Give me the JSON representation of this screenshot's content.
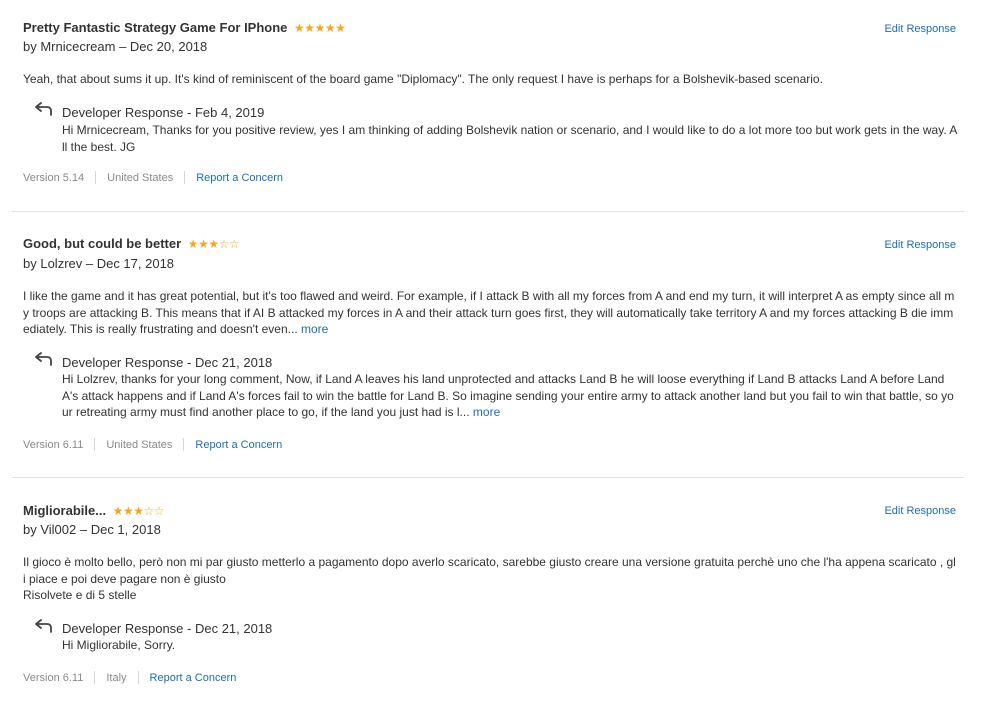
{
  "reviews": [
    {
      "title": "Pretty Fantastic Strategy Game For IPhone",
      "rating": 5,
      "author_line": "by Mrnicecream – Dec 20, 2018",
      "edit_label": "Edit Response",
      "body": "Yeah, that about sums it up. It's kind of reminiscent of the board game \"Diplomacy\". The only request I have is perhaps for a Bolshevik-based scenario.",
      "response_header": "Developer Response - Feb 4, 2019",
      "response_text": "Hi Mrnicecream, Thanks for you positive review, yes I am thinking of adding Bolshevik nation or scenario, and I would like to do a lot more too but work gets in the way. All the best. JG",
      "version": "Version 5.14",
      "country": "United States",
      "concern_label": "Report a Concern"
    },
    {
      "title": "Good, but could be better",
      "rating": 3,
      "author_line": "by Lolzrev – Dec 17, 2018",
      "edit_label": "Edit Response",
      "body": "I like the game and it has great potential, but it's too flawed and weird. For example, if I attack B with all my forces from A and end my turn, it will interpret A as empty since all my troops are attacking B. This means that if AI B attacked my forces in A and their attack turn goes first, they will automatically take territory A and my forces attacking B die immediately. This is really frustrating and doesn't even...",
      "body_more": "more",
      "response_header": "Developer Response - Dec 21, 2018",
      "response_text": "Hi Lolzrev, thanks for your long comment, Now, if Land A leaves his land unprotected and attacks Land B he will loose everything if Land B attacks Land A before Land A's attack happens and if Land A's forces fail to win the battle for Land B. So imagine sending your entire army to attack another land but you fail to win that battle, so your retreating army must find another place to go, if the land you just had is l...",
      "response_more": "more",
      "version": "Version 6.11",
      "country": "United States",
      "concern_label": "Report a Concern"
    },
    {
      "title": "Migliorabile...",
      "rating": 3,
      "author_line": "by Vil002 – Dec 1, 2018",
      "edit_label": "Edit Response",
      "body": "Il gioco è molto bello, però non mi par giusto metterlo a pagamento dopo averlo scaricato, sarebbe  giusto creare una versione gratuita perchè uno che l'ha appena scaricato , gli piace e poi deve pagare non è giusto",
      "body_line2": "Risolvete e di 5 stelle",
      "response_header": "Developer Response - Dec 21, 2018",
      "response_text": "Hi Migliorabile, Sorry.",
      "version": "Version 6.11",
      "country": "Italy",
      "concern_label": "Report a Concern"
    }
  ],
  "colors": {
    "link": "#1a6fb0",
    "star": "#f5a623",
    "text": "#333333",
    "meta": "#8a8a8a",
    "divider": "#e3e3e3"
  },
  "icons": {
    "reply": "reply-arrow-icon",
    "star_filled": "star-filled-icon",
    "star_empty": "star-empty-icon"
  }
}
